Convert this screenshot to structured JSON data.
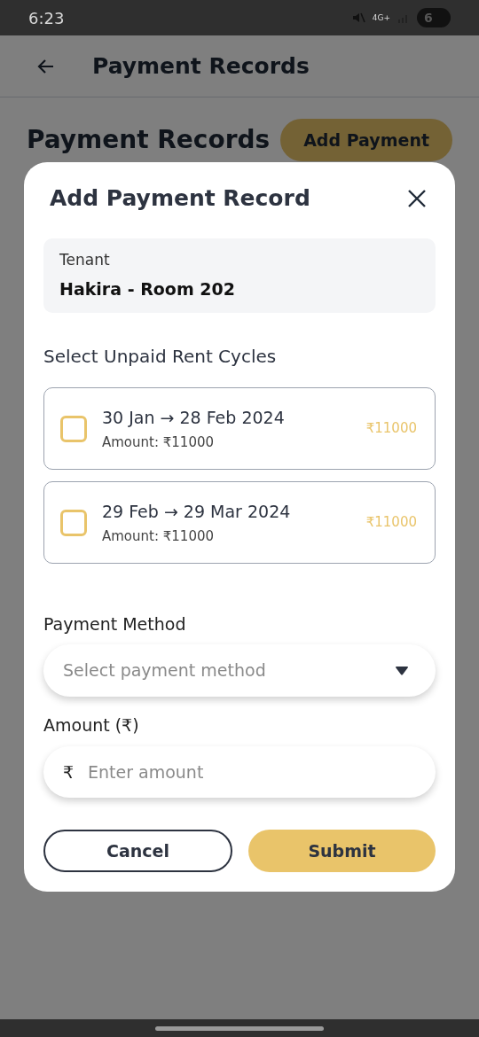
{
  "status_bar": {
    "time": "6:23",
    "network": "4G+",
    "battery": "6"
  },
  "app_bar": {
    "title": "Payment Records"
  },
  "page": {
    "heading": "Payment Records",
    "add_button": "Add Payment"
  },
  "dialog": {
    "title": "Add Payment Record",
    "tenant": {
      "label": "Tenant",
      "value": "Hakira - Room 202"
    },
    "cycles_heading": "Select Unpaid Rent Cycles",
    "cycles": [
      {
        "period": "30 Jan → 28 Feb 2024",
        "amount": "Amount: ₹11000",
        "total": "₹11000",
        "checked": false
      },
      {
        "period": "29 Feb → 29 Mar 2024",
        "amount": "Amount: ₹11000",
        "total": "₹11000",
        "checked": false
      }
    ],
    "payment_method": {
      "label": "Payment Method",
      "placeholder": "Select payment method"
    },
    "amount": {
      "label": "Amount (₹)",
      "prefix": "₹",
      "placeholder": "Enter amount"
    },
    "buttons": {
      "cancel": "Cancel",
      "submit": "Submit"
    }
  }
}
